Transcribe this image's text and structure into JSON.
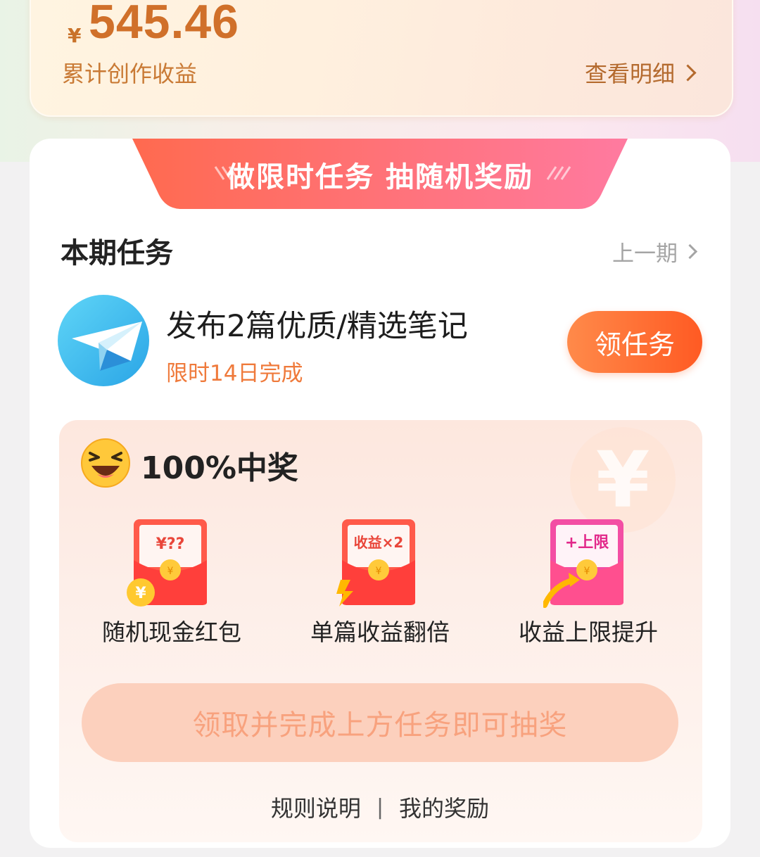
{
  "earnings": {
    "currency": "¥",
    "amount": "545.46",
    "label": "累计创作收益",
    "detail_link": "查看明细"
  },
  "banner": {
    "text": "做限时任务 抽随机奖励"
  },
  "tasks": {
    "section_title": "本期任务",
    "prev_period": "上一期",
    "item": {
      "title": "发布2篇优质/精选笔记",
      "subtitle": "限时14日完成",
      "button": "领任务",
      "icon": "paper-plane-icon"
    }
  },
  "lottery": {
    "title": "100%中奖",
    "rewards": [
      {
        "label": "随机现金红包",
        "card_text": "¥??",
        "icon": "red-envelope-cash-icon"
      },
      {
        "label": "单篇收益翻倍",
        "card_text": "收益×2",
        "icon": "red-envelope-double-icon"
      },
      {
        "label": "收益上限提升",
        "card_text": "+上限",
        "icon": "red-envelope-limit-icon"
      }
    ],
    "coin_symbol": "¥",
    "draw_button": "领取并完成上方任务即可抽奖"
  },
  "footer": {
    "rules": "规则说明",
    "separator": "|",
    "my_rewards": "我的奖励"
  },
  "colors": {
    "accent_orange": "#ff5a23",
    "amount": "#d0702a",
    "banner_start": "#ff6a4f",
    "banner_end": "#ff7aa0"
  }
}
